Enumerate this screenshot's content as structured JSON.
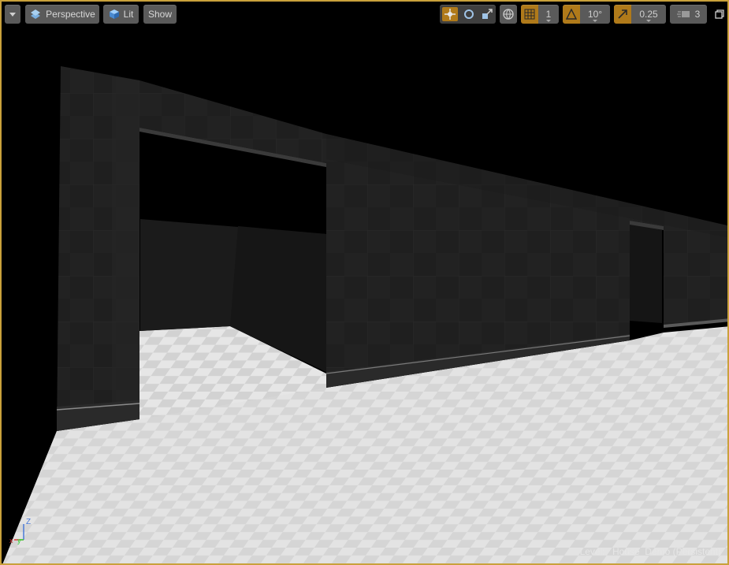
{
  "toolbar": {
    "view_mode_label": "Perspective",
    "lighting_label": "Lit",
    "show_label": "Show",
    "grid_snap_value": "1",
    "rotation_snap_value": "10°",
    "scale_snap_value": "0.25",
    "camera_speed_value": "3"
  },
  "status": {
    "level_prefix": "Level:",
    "level_name": "House_Demo (Persistent)"
  },
  "gizmo": {
    "z_label": "Z"
  },
  "colors": {
    "viewport_border": "#c9a13b",
    "toolbar_button": "#5a5a5a",
    "toolbar_active": "#b07a1a"
  }
}
